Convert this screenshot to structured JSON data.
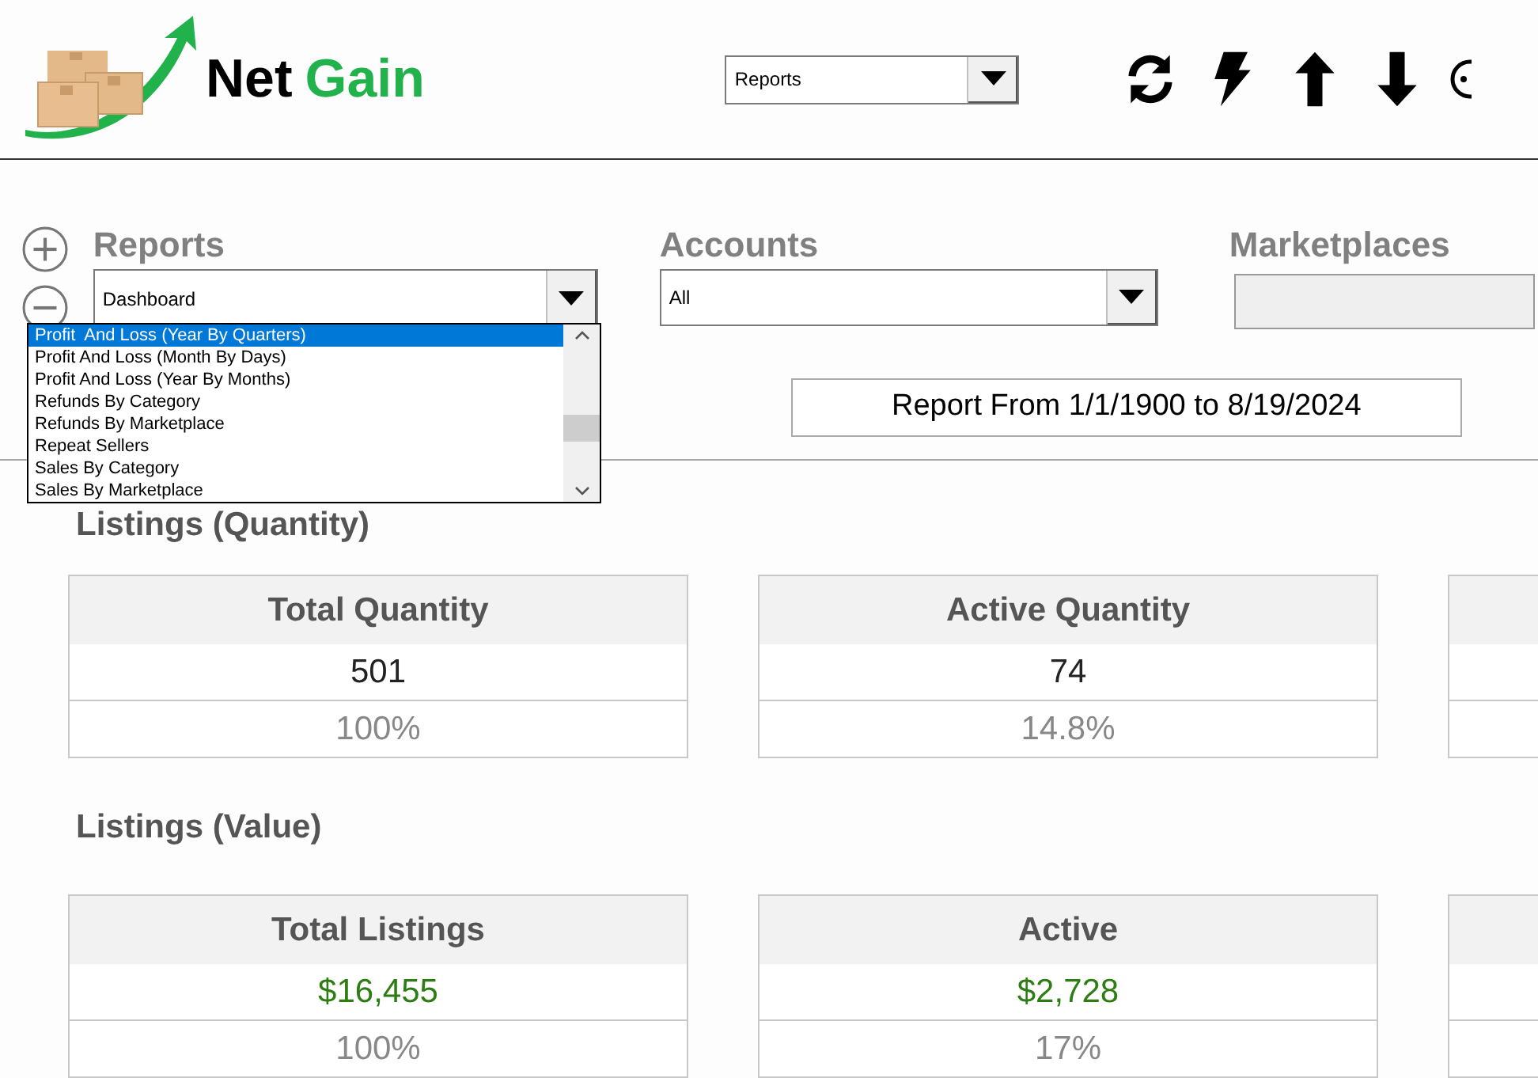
{
  "header": {
    "logo": {
      "word_1": "Net",
      "word_2": "Gain"
    },
    "view_select": {
      "value": "Reports"
    },
    "toolbar": [
      {
        "kind": "refresh"
      },
      {
        "kind": "bolt"
      },
      {
        "kind": "upload"
      },
      {
        "kind": "download"
      },
      {
        "kind": "more"
      }
    ]
  },
  "filters": {
    "zoom_buttons": [
      {
        "kind": "plus"
      },
      {
        "kind": "minus"
      }
    ],
    "reports": {
      "label": "Reports",
      "value": "Dashboard",
      "expanded": true,
      "options": [
        {
          "label": "Profit  And Loss (Year By Quarters)",
          "selected": true
        },
        {
          "label": "Profit And Loss (Month By Days)",
          "selected": false
        },
        {
          "label": "Profit And Loss (Year By Months)",
          "selected": false
        },
        {
          "label": "Refunds By Category",
          "selected": false
        },
        {
          "label": "Refunds By Marketplace",
          "selected": false
        },
        {
          "label": "Repeat Sellers",
          "selected": false
        },
        {
          "label": "Sales By Category",
          "selected": false
        },
        {
          "label": "Sales By Marketplace",
          "selected": false
        }
      ]
    },
    "accounts": {
      "label": "Accounts",
      "value": "All"
    },
    "marketplaces": {
      "label": "Marketplaces",
      "disabled": true
    },
    "report_range": "Report From 1/1/1900 to 8/19/2024"
  },
  "sections": [
    {
      "title": "Listings (Quantity)",
      "cards": [
        {
          "title": "Total Quantity",
          "value": "501",
          "kind": "count",
          "percent": "100%"
        },
        {
          "title": "Active Quantity",
          "value": "74",
          "kind": "count",
          "percent": "14.8%"
        }
      ]
    },
    {
      "title": "Listings (Value)",
      "cards": [
        {
          "title": "Total Listings",
          "value": "$16,455",
          "kind": "money",
          "percent": "100%"
        },
        {
          "title": "Active",
          "value": "$2,728",
          "kind": "money",
          "percent": "17%"
        }
      ]
    }
  ]
}
